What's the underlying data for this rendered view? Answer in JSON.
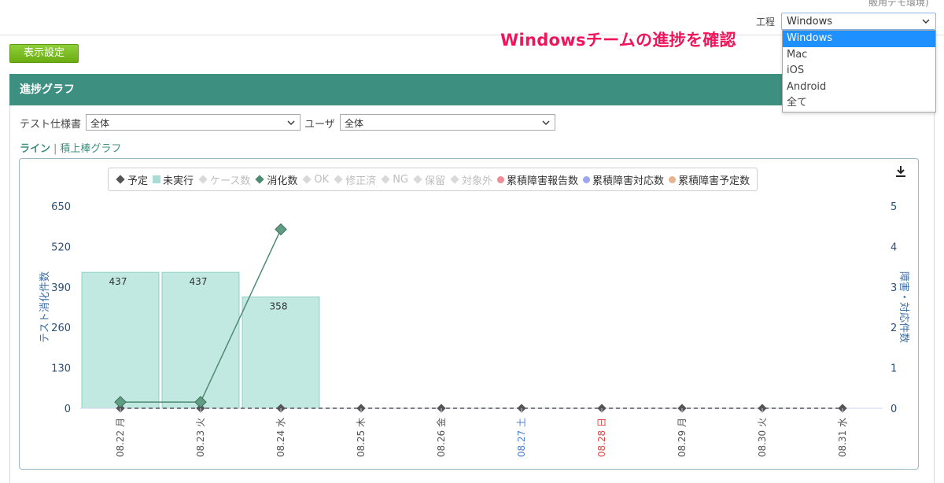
{
  "header": {
    "top_note": "販用デモ環境)",
    "process_label": "工程",
    "process_selected": "Windows",
    "process_options": [
      "Windows",
      "Mac",
      "iOS",
      "Android",
      "全て"
    ],
    "annotation": "Windowsチームの進捗を確認"
  },
  "toolbar": {
    "settings_label": "表示設定"
  },
  "panel": {
    "title": "進捗グラフ",
    "filters": {
      "spec_label": "テスト仕様書",
      "spec_value": "全体",
      "user_label": "ユーザ",
      "user_value": "全体"
    },
    "view_toggle": {
      "line_label": "ライン",
      "stack_label": "積上棒グラフ"
    }
  },
  "legend": [
    {
      "label": "予定",
      "marker": "diamond",
      "color": "#555555",
      "active": true
    },
    {
      "label": "未実行",
      "marker": "square",
      "color": "#a8ddd6",
      "active": true
    },
    {
      "label": "ケース数",
      "marker": "diamond",
      "color": "#d9d9d9",
      "active": false
    },
    {
      "label": "消化数",
      "marker": "diamond",
      "color": "#4f8a73",
      "active": true
    },
    {
      "label": "OK",
      "marker": "diamond",
      "color": "#d9d9d9",
      "active": false
    },
    {
      "label": "修正済",
      "marker": "diamond",
      "color": "#d9d9d9",
      "active": false
    },
    {
      "label": "NG",
      "marker": "diamond",
      "color": "#d9d9d9",
      "active": false
    },
    {
      "label": "保留",
      "marker": "diamond",
      "color": "#d9d9d9",
      "active": false
    },
    {
      "label": "対象外",
      "marker": "diamond",
      "color": "#d9d9d9",
      "active": false
    },
    {
      "label": "累積障害報告数",
      "marker": "circle",
      "color": "#f08c96",
      "active": true
    },
    {
      "label": "累積障害対応数",
      "marker": "circle",
      "color": "#9aa6ee",
      "active": true
    },
    {
      "label": "累積障害予定数",
      "marker": "circle",
      "color": "#e7b38e",
      "active": true
    }
  ],
  "chart_data": {
    "type": "bar",
    "categories": [
      "08.22 月",
      "08.23 火",
      "08.24 水",
      "08.25 木",
      "08.26 金",
      "08.27 土",
      "08.28 日",
      "08.29 月",
      "08.30 火",
      "08.31 水"
    ],
    "category_colors": [
      "#555555",
      "#555555",
      "#555555",
      "#555555",
      "#555555",
      "#4a7fd4",
      "#e04848",
      "#555555",
      "#555555",
      "#555555"
    ],
    "ylabel": "テスト消化件数",
    "y2label": "障害・対応件数",
    "ylim": [
      0,
      650
    ],
    "yticks": [
      0,
      130,
      260,
      390,
      520,
      650
    ],
    "y2lim": [
      0,
      5
    ],
    "y2ticks": [
      0,
      1,
      2,
      3,
      4,
      5
    ],
    "series": [
      {
        "name": "未実行",
        "kind": "bar",
        "color": "#c2e8e2",
        "values": [
          437,
          437,
          358,
          null,
          null,
          null,
          null,
          null,
          null,
          null
        ]
      },
      {
        "name": "消化数",
        "kind": "line",
        "color": "#4f8a73",
        "values": [
          20,
          20,
          575,
          null,
          null,
          null,
          null,
          null,
          null,
          null
        ]
      },
      {
        "name": "予定",
        "kind": "dashed-line",
        "color": "#555555",
        "values": [
          0,
          0,
          0,
          0,
          0,
          0,
          0,
          0,
          0,
          0
        ]
      }
    ]
  }
}
